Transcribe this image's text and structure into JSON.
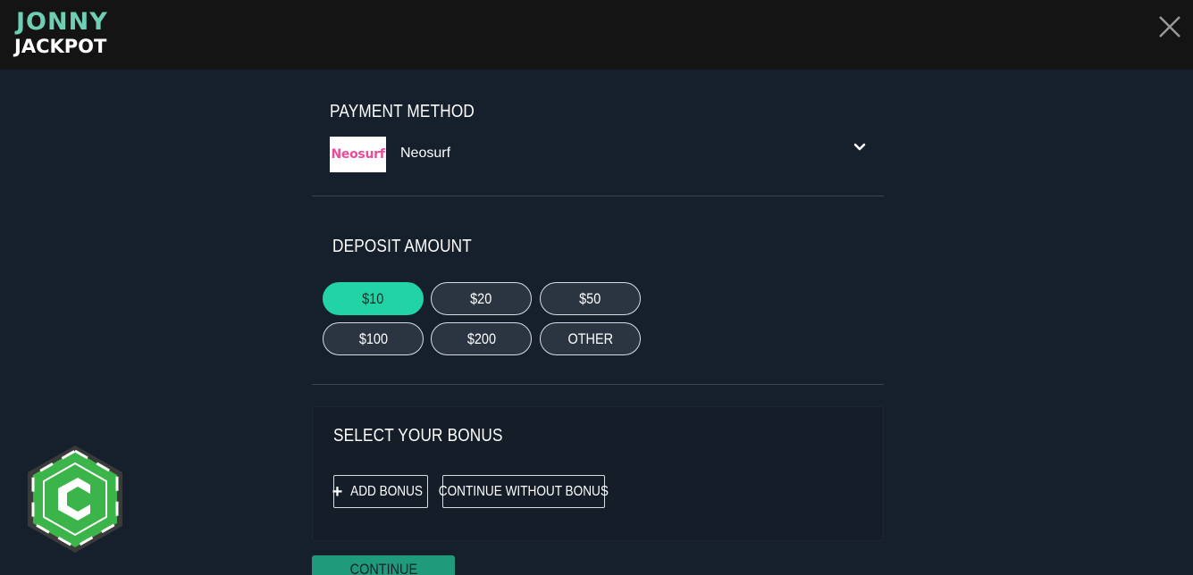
{
  "header": {
    "logo_line1": "JONNY",
    "logo_line2": "JACKPOT",
    "close_icon": "close-icon"
  },
  "payment": {
    "title": "PAYMENT METHOD",
    "method_logo_text": "Neosurf",
    "method_name": "Neosurf",
    "dropdown_icon": "chevron-down-icon"
  },
  "deposit": {
    "title": "DEPOSIT AMOUNT",
    "amounts": [
      "$10",
      "$20",
      "$50",
      "$100",
      "$200",
      "OTHER"
    ],
    "selected": "$10"
  },
  "bonus": {
    "title": "SELECT YOUR BONUS",
    "add_label": "ADD BONUS",
    "no_bonus_label": "CONTINUE WITHOUT BONUS"
  },
  "continue_label": "CONTINUE",
  "chat_badge_letter": "C",
  "colors": {
    "accent": "#22d3a5",
    "background": "#16202c",
    "topbar": "#141414",
    "logo_teal": "#6ecfb4",
    "neosurf_pink": "#ec4b9a",
    "badge_green": "#3bb54a"
  }
}
